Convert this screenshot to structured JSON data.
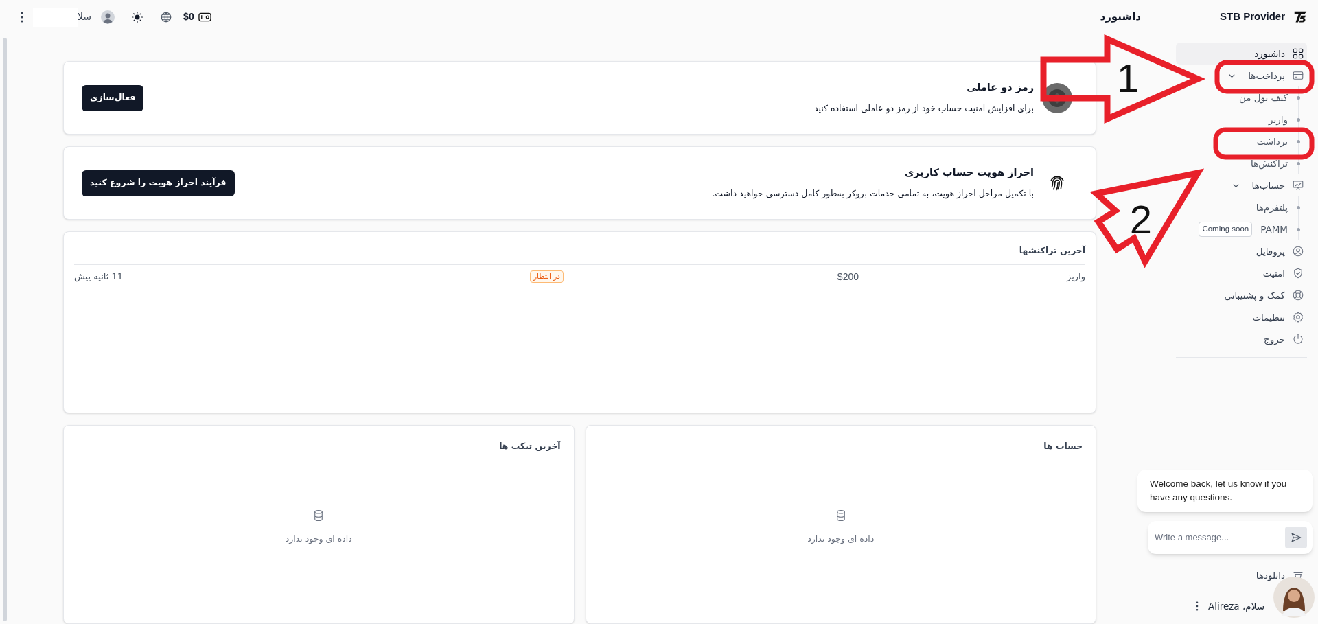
{
  "top_bar": {
    "brand": "STB Provider",
    "page_title": "داشبورد",
    "balance": "$0",
    "user_name": "سلا"
  },
  "sidebar": {
    "items": [
      {
        "label": "داشبورد",
        "selected": true
      },
      {
        "label": "پرداخت‌ها",
        "selected": false,
        "expanded": true,
        "children": [
          {
            "label": "کیف پول من",
            "selected": false
          },
          {
            "label": "واریز",
            "selected": false
          },
          {
            "label": "برداشت",
            "selected": false
          },
          {
            "label": "تراکنش‌ها",
            "selected": false
          }
        ]
      },
      {
        "label": "حساب‌ها",
        "selected": false,
        "expanded": true,
        "children": [
          {
            "label": "پلتفرم‌ها",
            "selected": false
          },
          {
            "label": "PAMM",
            "badge": "Coming soon",
            "selected": false
          }
        ]
      },
      {
        "label": "پروفایل",
        "selected": false
      },
      {
        "label": "امنیت",
        "selected": false
      },
      {
        "label": "کمک و پشتیبانی",
        "selected": false
      },
      {
        "label": "تنظیمات",
        "selected": false
      },
      {
        "label": "خروج",
        "selected": false
      }
    ],
    "footer_items": [
      {
        "label": "دانلودها"
      }
    ],
    "greeting": "سلام، Alireza"
  },
  "cards": [
    {
      "title": "رمز دو عاملی",
      "description": "برای افزایش امنیت حساب خود از رمز دو عاملی استفاده کنید",
      "button": "فعال‌سازی"
    },
    {
      "title": "احراز هویت حساب کاربری",
      "description": "با تکمیل مراحل احراز هویت، به تمامی خدمات بروکر به‌طور کامل دسترسی خواهید داشت.",
      "button": "فرآیند احراز هویت را شروع کنید"
    }
  ],
  "recent_transactions": {
    "title": "آخرین تراکنشها",
    "rows": [
      {
        "type": "واریز",
        "amount": "$200",
        "status": "در انتظار",
        "time": "11 ثانیه پیش"
      }
    ]
  },
  "panels": [
    {
      "title": "حساب ها",
      "empty_text": "داده ای وجود ندارد"
    },
    {
      "title": "آخرین تیکت ها",
      "empty_text": "داده ای وجود ندارد"
    }
  ],
  "chat": {
    "message": "Welcome back, let us know if you have any questions.",
    "placeholder": "Write a message..."
  },
  "annotations": [
    {
      "kind": "arrow",
      "label": "1"
    },
    {
      "kind": "highlight"
    },
    {
      "kind": "highlight"
    },
    {
      "kind": "arrow",
      "label": "2"
    }
  ]
}
